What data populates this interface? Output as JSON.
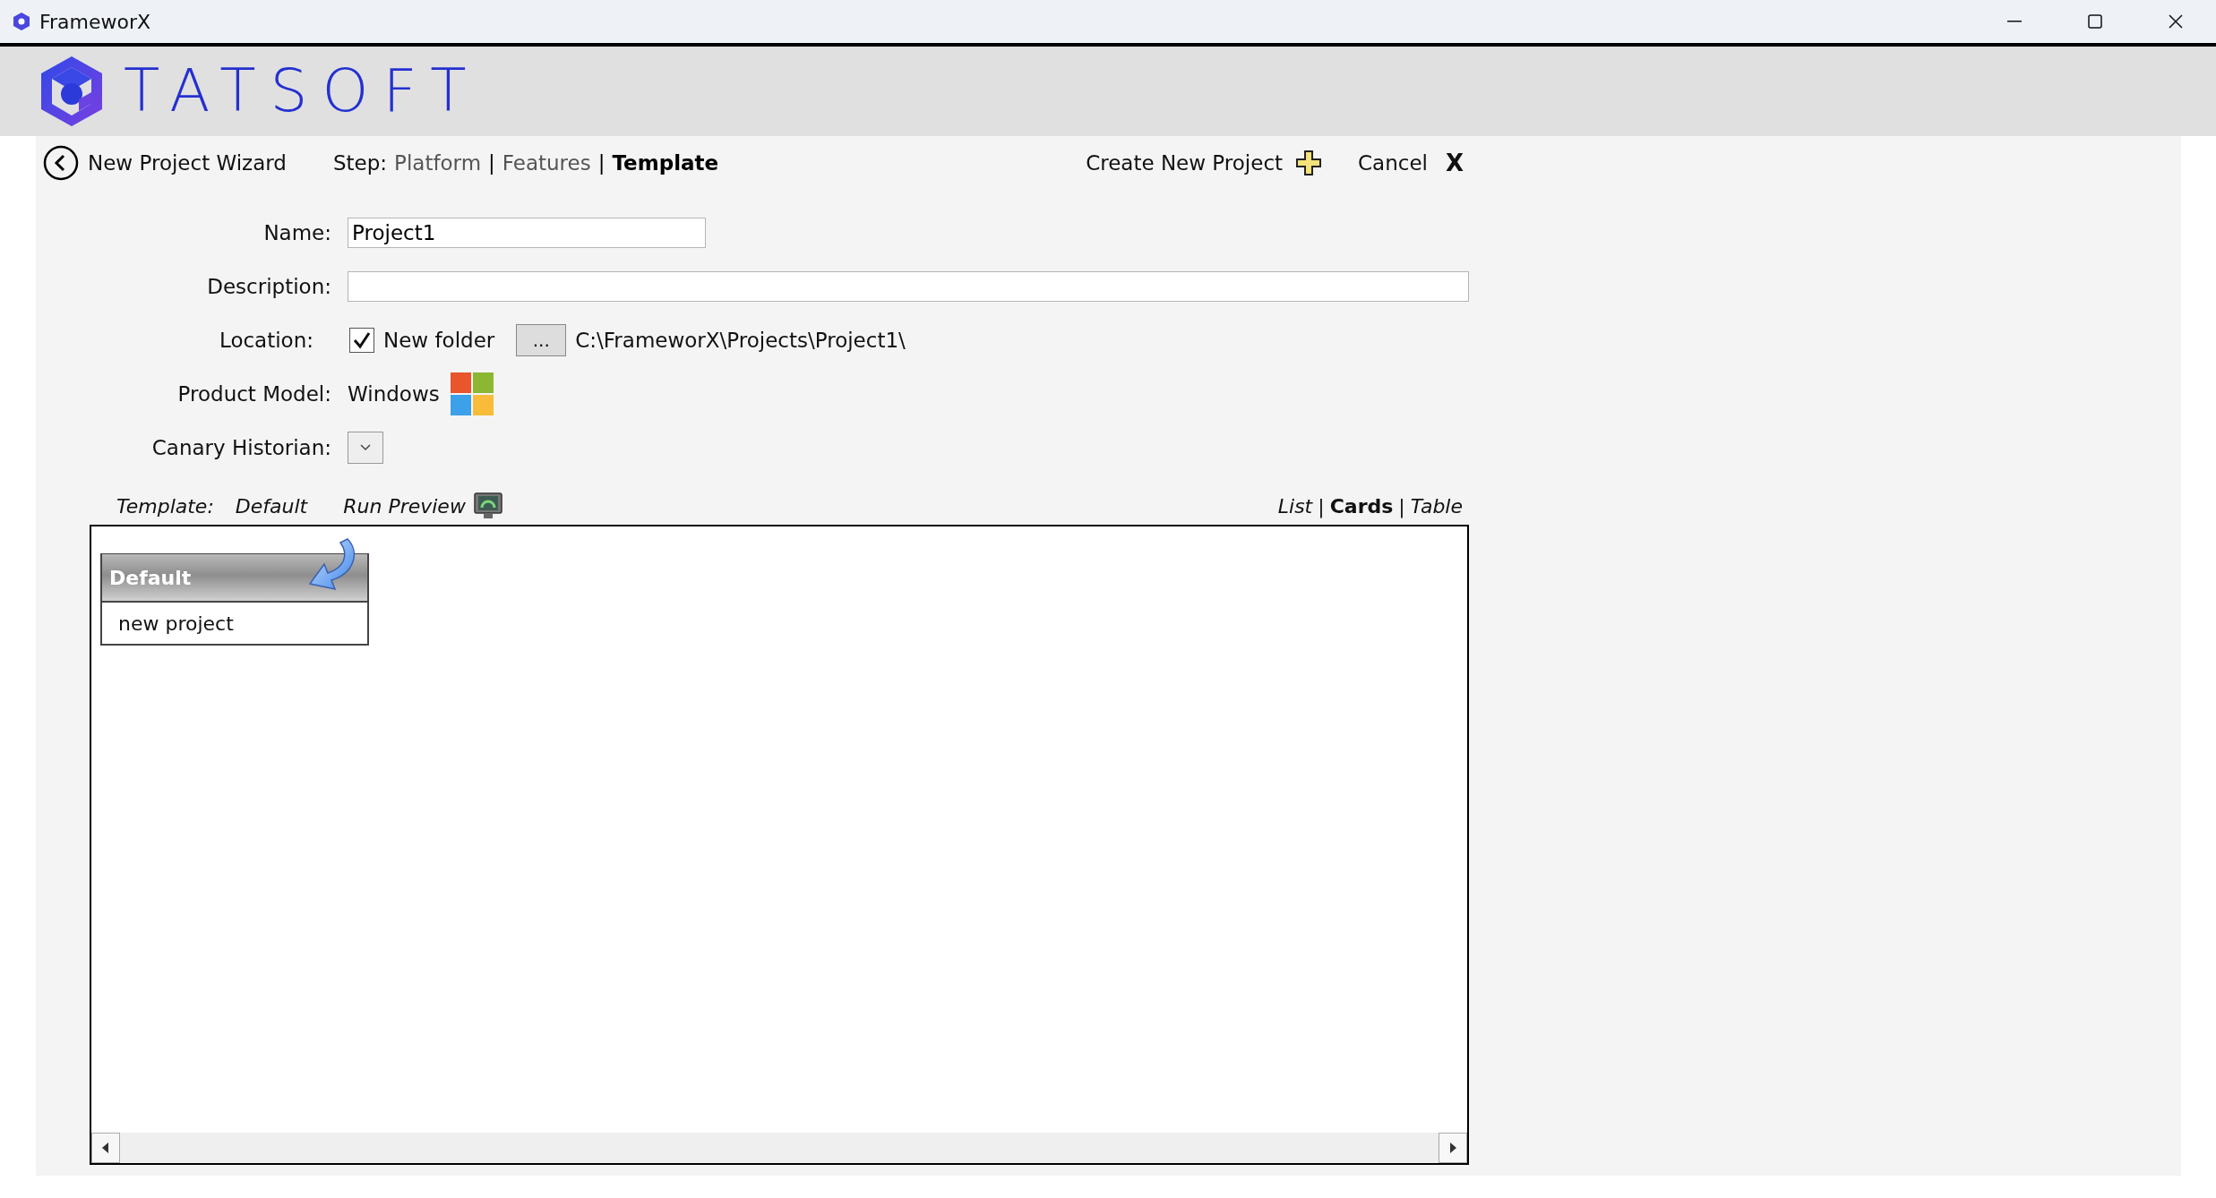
{
  "window": {
    "title": "FrameworX"
  },
  "header": {
    "logo_text": "TATSOFT"
  },
  "wizard": {
    "title": "New Project Wizard",
    "step_label": "Step:",
    "steps": [
      {
        "label": "Platform",
        "selected": false
      },
      {
        "label": "Features",
        "separator": "|",
        "selected": false
      },
      {
        "label": "Template",
        "separator": "|",
        "selected": true
      }
    ],
    "actions": [
      {
        "kind": "create",
        "label": "Create New Project"
      },
      {
        "kind": "cancel",
        "label": "Cancel",
        "icon": "X"
      }
    ]
  },
  "form": {
    "name": {
      "label": "Name:",
      "value": "Project1"
    },
    "description": {
      "label": "Description:"
    },
    "location": {
      "label": "Location:",
      "new_folder": {
        "label": "New folder",
        "checked": true
      },
      "browse_button": "...",
      "path": "C:\\FrameworX\\Projects\\Project1\\"
    },
    "product_model": {
      "label": "Product Model:",
      "value": "Windows"
    },
    "canary_historian": {
      "label": "Canary Historian:"
    }
  },
  "template_bar": {
    "label": "Template:",
    "value": "Default",
    "run_preview": "Run Preview",
    "views": [
      {
        "label": "List",
        "selected": false
      },
      {
        "label": "Cards",
        "separator": "|",
        "selected": true
      },
      {
        "label": "Table",
        "separator": "|",
        "selected": false
      }
    ]
  },
  "cards": [
    {
      "title": "Default",
      "description": "new project"
    }
  ]
}
